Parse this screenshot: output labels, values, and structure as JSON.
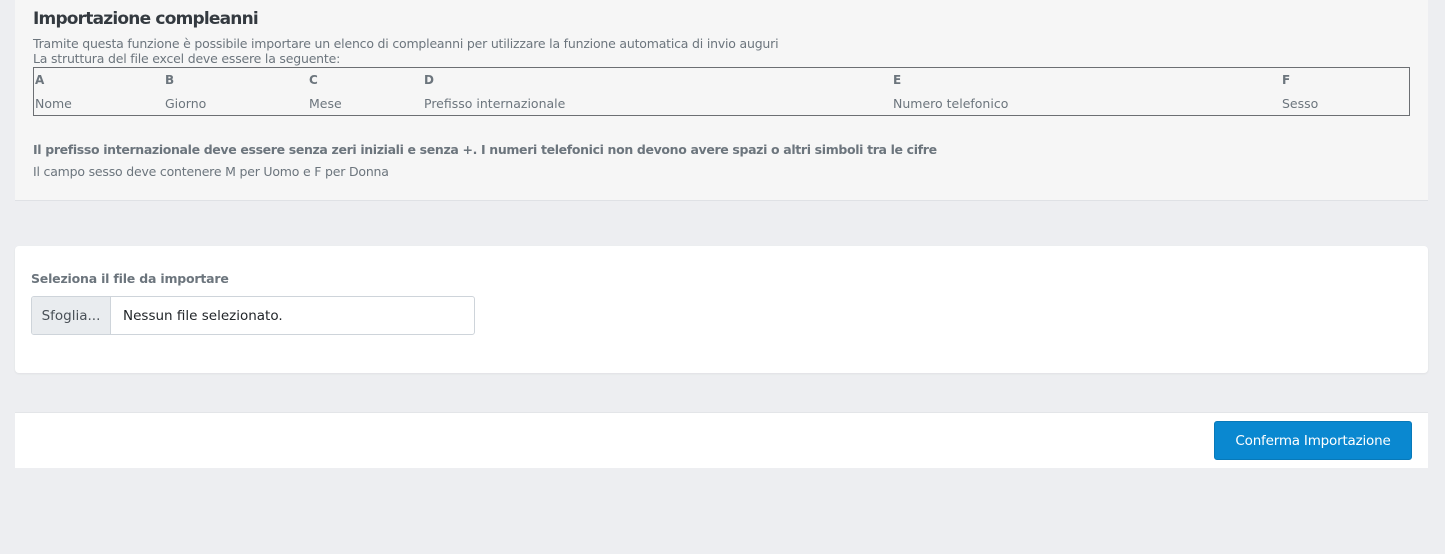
{
  "info": {
    "title": "Importazione compleanni",
    "description_line1": "Tramite questa funzione è possibile importare un elenco di compleanni per utilizzare la funzione automatica di invio auguri",
    "description_line2": "La struttura del file excel deve essere la seguente:",
    "columns": [
      {
        "letter": "A",
        "name": "Nome"
      },
      {
        "letter": "B",
        "name": "Giorno"
      },
      {
        "letter": "C",
        "name": "Mese"
      },
      {
        "letter": "D",
        "name": "Prefisso internazionale"
      },
      {
        "letter": "E",
        "name": "Numero telefonico"
      },
      {
        "letter": "F",
        "name": "Sesso"
      }
    ],
    "note_bold": "Il prefisso internazionale deve essere senza zeri iniziali e senza +. I numeri telefonici non devono avere spazi o altri simboli tra le cifre",
    "note_plain": "Il campo sesso deve contenere M per Uomo e F per Donna"
  },
  "upload": {
    "label": "Seleziona il file da importare",
    "browse_label": "Sfoglia...",
    "file_status": "Nessun file selezionato."
  },
  "footer": {
    "confirm_label": "Conferma Importazione"
  },
  "colors": {
    "primary": "#0a88d0",
    "background": "#edeef1",
    "panel": "#f6f6f6"
  }
}
